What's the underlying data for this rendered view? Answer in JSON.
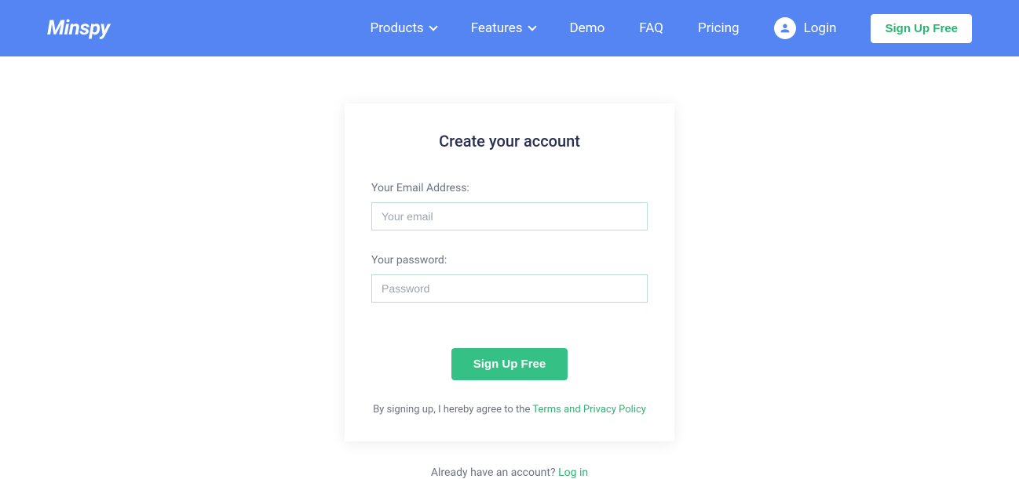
{
  "header": {
    "logo": "Minspy",
    "nav": {
      "products": "Products",
      "features": "Features",
      "demo": "Demo",
      "faq": "FAQ",
      "pricing": "Pricing"
    },
    "login": "Login",
    "signup": "Sign Up Free"
  },
  "form": {
    "title": "Create your account",
    "email_label": "Your Email Address:",
    "email_placeholder": "Your email",
    "password_label": "Your password:",
    "password_placeholder": "Password",
    "submit": "Sign Up Free",
    "terms_prefix": "By signing up, I hereby agree to the ",
    "terms_link": "Terms and Privacy Policy"
  },
  "footer": {
    "prompt": "Already have an account? ",
    "login_link": "Log in"
  }
}
